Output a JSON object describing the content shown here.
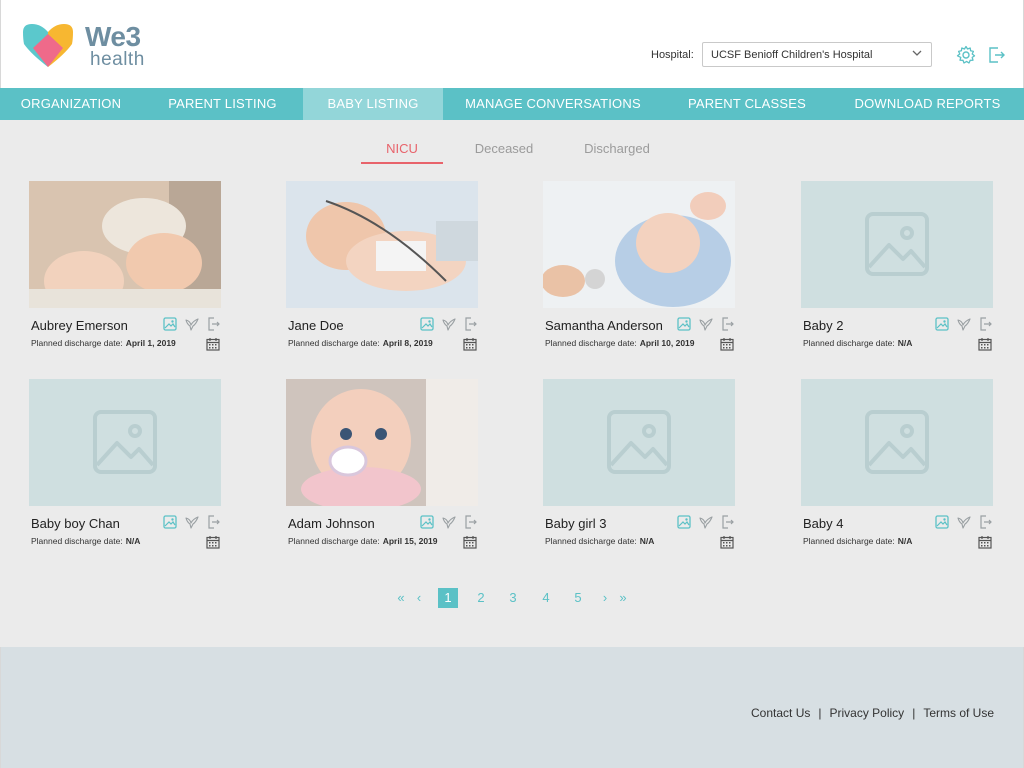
{
  "brand": {
    "name_top": "We3",
    "name_bottom": "health"
  },
  "header": {
    "hospital_label": "Hospital:",
    "hospital_selected": "UCSF Benioff Children's Hospital",
    "icons": [
      "gear-icon",
      "logout-icon"
    ]
  },
  "nav": {
    "items": [
      {
        "label": "ORGANIZATION"
      },
      {
        "label": "PARENT LISTING"
      },
      {
        "label": "BABY LISTING",
        "active": true
      },
      {
        "label": "MANAGE CONVERSATIONS"
      },
      {
        "label": "PARENT CLASSES"
      },
      {
        "label": "DOWNLOAD REPORTS"
      }
    ]
  },
  "subtabs": [
    {
      "label": "NICU",
      "active": true
    },
    {
      "label": "Deceased"
    },
    {
      "label": "Discharged"
    }
  ],
  "babies": [
    {
      "name": "Aubrey Emerson",
      "discharge_label": "Planned discharge date:",
      "discharge_value": "April 1, 2019",
      "photo": "baby-in-knit-hat-photo"
    },
    {
      "name": "Jane Doe",
      "discharge_label": "Planned discharge date:",
      "discharge_value": "April 8, 2019",
      "photo": "baby-in-nicu-photo"
    },
    {
      "name": "Samantha Anderson",
      "discharge_label": "Planned discharge date:",
      "discharge_value": "April 10, 2019",
      "photo": "baby-with-stethoscope-photo"
    },
    {
      "name": "Baby 2",
      "discharge_label": "Planned discharge date:",
      "discharge_value": "N/A",
      "photo": "placeholder"
    },
    {
      "name": "Baby boy Chan",
      "discharge_label": "Planned discharge date:",
      "discharge_value": "N/A",
      "photo": "placeholder"
    },
    {
      "name": "Adam Johnson",
      "discharge_label": "Planned discharge date:",
      "discharge_value": "April 15, 2019",
      "photo": "baby-with-pacifier-photo"
    },
    {
      "name": "Baby girl 3",
      "discharge_label": "Planned dsicharge date:",
      "discharge_value": "N/A",
      "photo": "placeholder"
    },
    {
      "name": "Baby 4",
      "discharge_label": "Planned dsicharge date:",
      "discharge_value": "N/A",
      "photo": "placeholder"
    }
  ],
  "pager": {
    "first": "«",
    "prev": "‹",
    "next": "›",
    "last": "»",
    "pages": [
      "1",
      "2",
      "3",
      "4",
      "5"
    ],
    "current": "1"
  },
  "footer": {
    "contact": "Contact Us",
    "privacy": "Privacy Policy",
    "terms": "Terms of Use",
    "separator": "|"
  },
  "colors": {
    "accent": "#5bc1c6",
    "active_tab": "#e8636b",
    "placeholder": "#cfdfe0"
  }
}
